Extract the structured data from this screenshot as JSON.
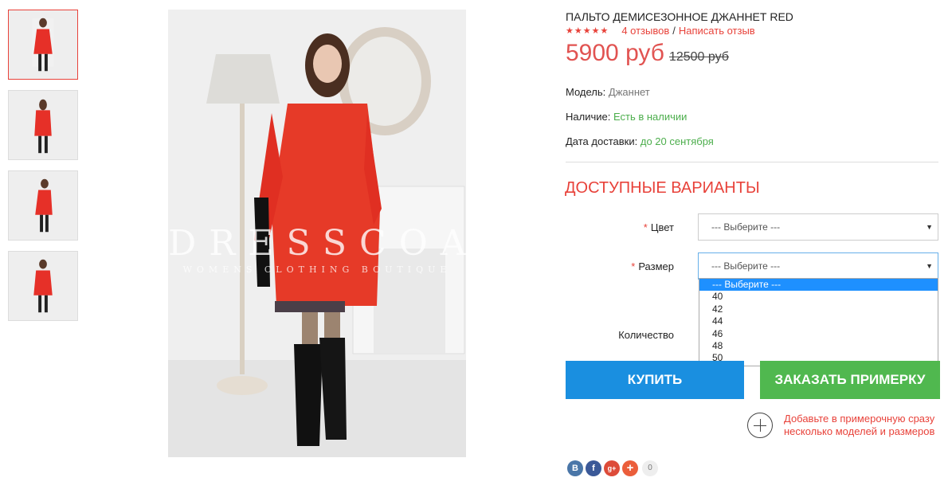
{
  "gallery": {
    "main_watermark": "DRESSCOAT",
    "main_watermark_sub": "WOMENS CLOTHING BOUTIQUE",
    "thumbnails_count": 4
  },
  "product": {
    "title": "ПАЛЬТО ДЕМИСЕЗОННОЕ ДЖАННЕТ RED",
    "stars": "★★★★★",
    "rating": 5,
    "reviews_link": "4 отзывов",
    "separator": "/",
    "write_review_link": "Написать отзыв",
    "price_new": "5900 руб",
    "price_old": "12500 руб",
    "model_label": "Модель:",
    "model_value": "Джаннет",
    "availability_label": "Наличие:",
    "availability_value": "Есть в наличии",
    "delivery_label": "Дата доставки:",
    "delivery_value": "до 20 сентября"
  },
  "options": {
    "heading": "ДОСТУПНЫЕ ВАРИАНТЫ",
    "required_mark": "*",
    "color_label": "Цвет",
    "color_selected": "--- Выберите ---",
    "size_label": "Размер",
    "size_selected": "--- Выберите ---",
    "size_options": [
      "--- Выберите ---",
      "40",
      "42",
      "44",
      "46",
      "48",
      "50"
    ],
    "quantity_label": "Количество",
    "arrow": "▼"
  },
  "actions": {
    "buy_label": "КУПИТЬ",
    "try_on_label": "ЗАКАЗАТЬ ПРИМЕРКУ",
    "add_fitting_text": "Добавьте в примерочную сразу несколько моделей и размеров"
  },
  "social": {
    "vk": "В",
    "fb": "f",
    "gplus": "g+",
    "share": "+",
    "count": "0"
  },
  "colors": {
    "accent_red": "#e8423a",
    "buy_blue": "#1a8fe0",
    "try_green": "#50b84f",
    "in_stock_green": "#4cae4c"
  }
}
